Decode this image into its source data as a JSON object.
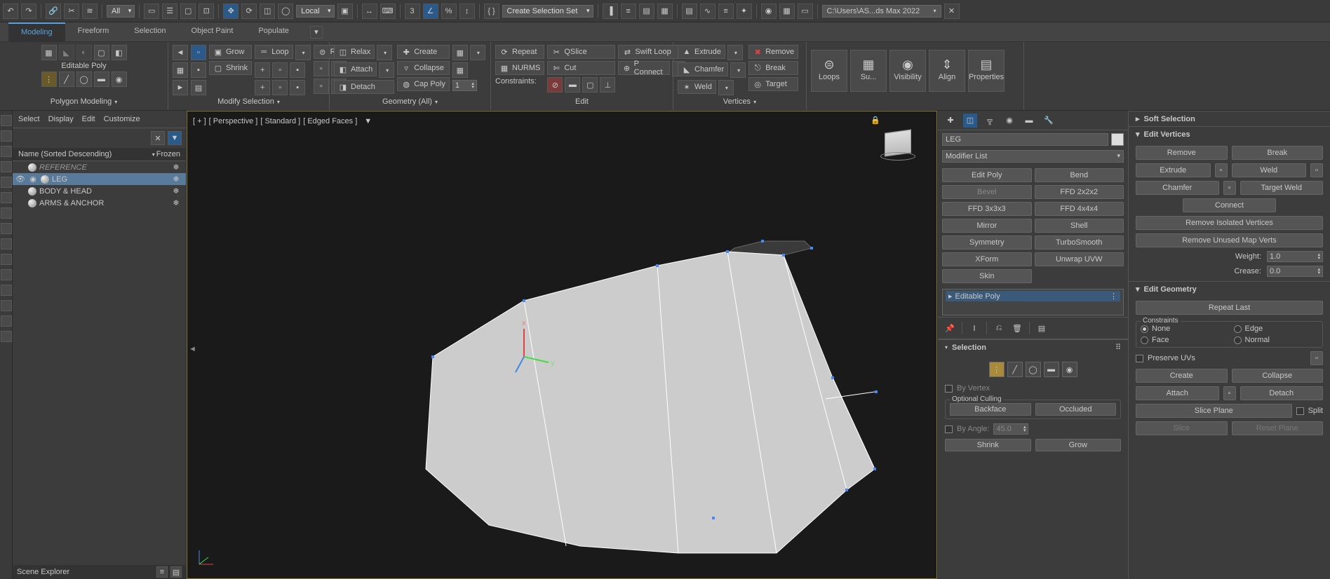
{
  "top": {
    "dd_all": "All",
    "dd_local": "Local",
    "dd_create_set": "Create Selection Set",
    "path": "C:\\Users\\AS...ds Max 2022"
  },
  "ribbon": {
    "tabs": [
      "Modeling",
      "Freeform",
      "Selection",
      "Object Paint",
      "Populate"
    ],
    "panel_editable_poly": "Editable Poly",
    "panel_polygon_modeling": "Polygon Modeling",
    "panel_modify_selection": "Modify Selection",
    "panel_geometry_all": "Geometry (All)",
    "panel_edit": "Edit",
    "panel_vertices": "Vertices",
    "btn_grow": "Grow",
    "btn_shrink": "Shrink",
    "btn_loop": "Loop",
    "btn_ring": "Ring",
    "btn_relax": "Relax",
    "btn_attach": "Attach",
    "btn_detach": "Detach",
    "btn_create": "Create",
    "btn_collapse": "Collapse",
    "btn_cap_poly": "Cap Poly",
    "btn_repeat": "Repeat",
    "btn_nurms": "NURMS",
    "constraints_label": "Constraints:",
    "btn_qslice": "QSlice",
    "btn_cut": "Cut",
    "btn_pconnect": "P Connect",
    "btn_swiftloop": "Swift Loop",
    "btn_extrude": "Extrude",
    "btn_chamfer": "Chamfer",
    "btn_weld": "Weld",
    "btn_remove": "Remove",
    "btn_break": "Break",
    "btn_target": "Target",
    "btn_loops": "Loops",
    "btn_sub": "Su...",
    "btn_visibility": "Visibility",
    "btn_align": "Align",
    "btn_properties": "Properties",
    "spin_one": "1"
  },
  "left": {
    "menu": [
      "Select",
      "Display",
      "Edit",
      "Customize"
    ],
    "header_name": "Name (Sorted Descending)",
    "header_frozen": "Frozen",
    "items": [
      {
        "label": "REFERENCE",
        "frozen": "❄"
      },
      {
        "label": "LEG",
        "frozen": "❄"
      },
      {
        "label": "BODY & HEAD",
        "frozen": "❄"
      },
      {
        "label": "ARMS & ANCHOR",
        "frozen": "❄"
      }
    ],
    "footer": "Scene Explorer"
  },
  "viewport": {
    "label_plus": "[ + ]",
    "label_persp": "[ Perspective ]",
    "label_std": "[ Standard ]",
    "label_edged": "[ Edged Faces ]"
  },
  "modify": {
    "obj_name": "LEG",
    "mod_list": "Modifier List",
    "buttons": [
      "Edit Poly",
      "Bend",
      "Bevel",
      "FFD 2x2x2",
      "FFD 3x3x3",
      "FFD 4x4x4",
      "Mirror",
      "Shell",
      "Symmetry",
      "TurboSmooth",
      "XForm",
      "Unwrap UVW",
      "Skin"
    ],
    "stack_item": "Editable Poly",
    "rollout_selection": "Selection",
    "by_vertex": "By Vertex",
    "optional_culling": "Optional Culling",
    "backface": "Backface",
    "occluded": "Occluded",
    "by_angle": "By Angle:",
    "by_angle_val": "45.0",
    "shrink": "Shrink",
    "grow": "Grow"
  },
  "props": {
    "soft_selection": "Soft Selection",
    "edit_vertices": "Edit Vertices",
    "remove": "Remove",
    "break": "Break",
    "extrude": "Extrude",
    "weld": "Weld",
    "chamfer": "Chamfer",
    "target_weld": "Target Weld",
    "connect": "Connect",
    "remove_iso": "Remove Isolated Vertices",
    "remove_unused": "Remove Unused Map Verts",
    "weight": "Weight:",
    "weight_val": "1.0",
    "crease": "Crease:",
    "crease_val": "0.0",
    "edit_geometry": "Edit Geometry",
    "repeat_last": "Repeat Last",
    "constraints": "Constraints",
    "none": "None",
    "edge": "Edge",
    "face": "Face",
    "normal": "Normal",
    "preserve_uvs": "Preserve UVs",
    "create": "Create",
    "collapse": "Collapse",
    "attach": "Attach",
    "detach": "Detach",
    "slice_plane": "Slice Plane",
    "split": "Split",
    "slice": "Slice",
    "reset_plane": "Reset Plane"
  }
}
